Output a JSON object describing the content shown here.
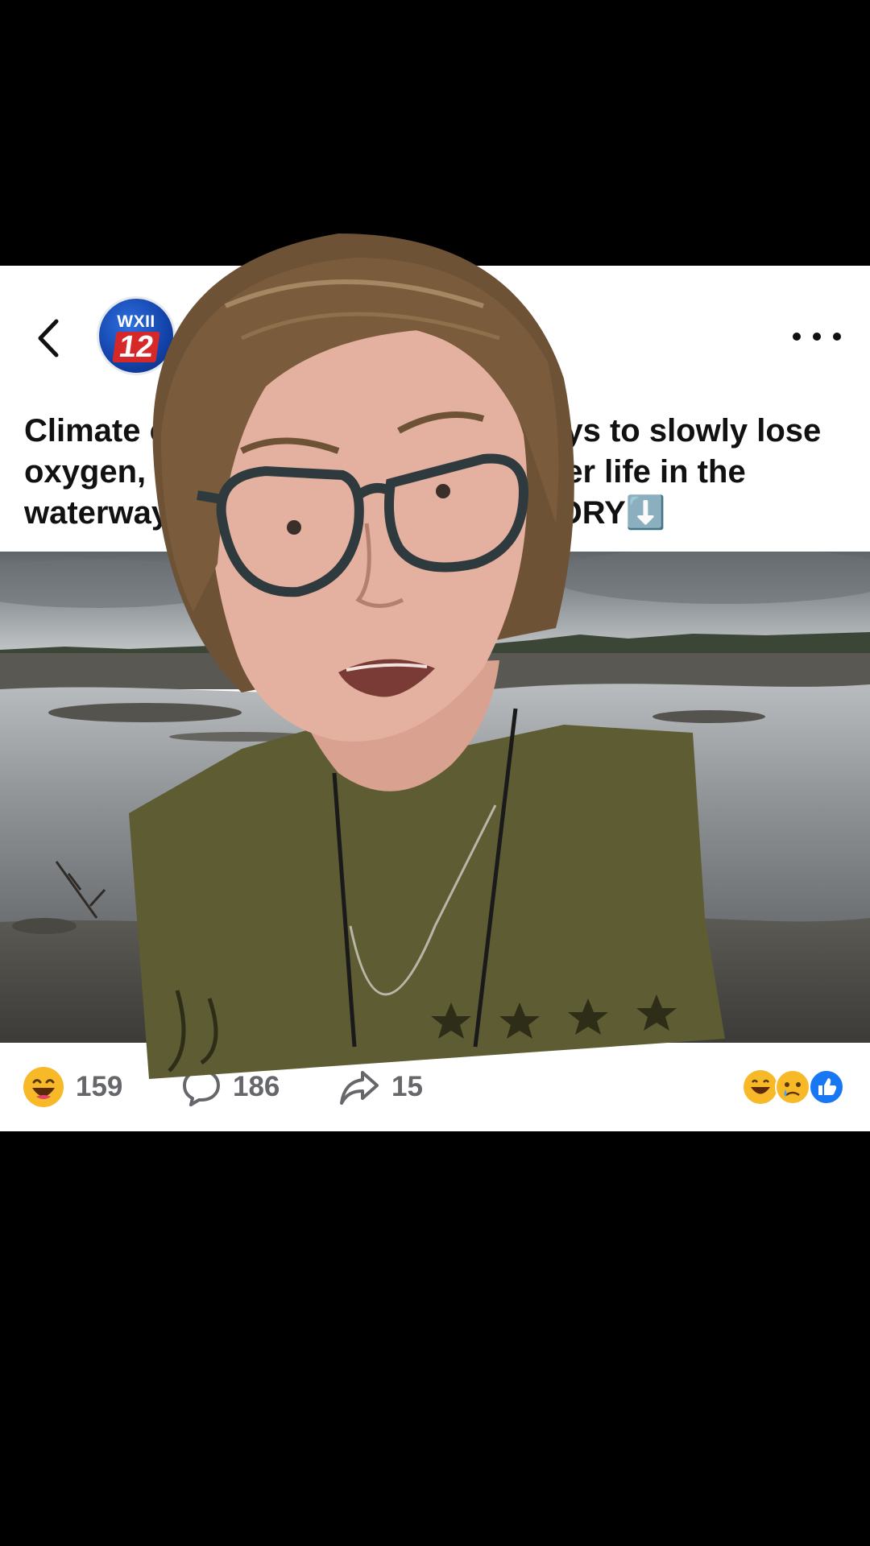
{
  "post": {
    "page_avatar": {
      "brand": "WXII",
      "number": "12"
    },
    "caption": "Climate change is causing waterways to slowly lose oxygen, which could be fatal to water life in the waterways. TAP FOR THE FULL STORY⬇️",
    "caption_visible_lines": [
      "Climate",
      "o slowly lose",
      "oxygen,",
      "r life in the",
      "waterwa",
      "ULL STORY⬇️"
    ],
    "media_description_icon": "lake-drought-photo"
  },
  "engagement": {
    "reactions_count": "159",
    "comments_count": "186",
    "shares_count": "15",
    "reaction_icon": "laugh-reaction-icon",
    "comment_icon": "comment-bubble-icon",
    "share_icon": "share-arrow-icon",
    "summary_icons": [
      "laugh-reaction-icon",
      "sad-reaction-icon",
      "like-reaction-icon"
    ]
  },
  "colors": {
    "background": "#000000",
    "card": "#ffffff",
    "text": "#111111",
    "muted": "#65676b",
    "like_blue": "#1877f2",
    "reaction_yellow": "#f7b928",
    "shirt_olive": "#5d5c33"
  }
}
